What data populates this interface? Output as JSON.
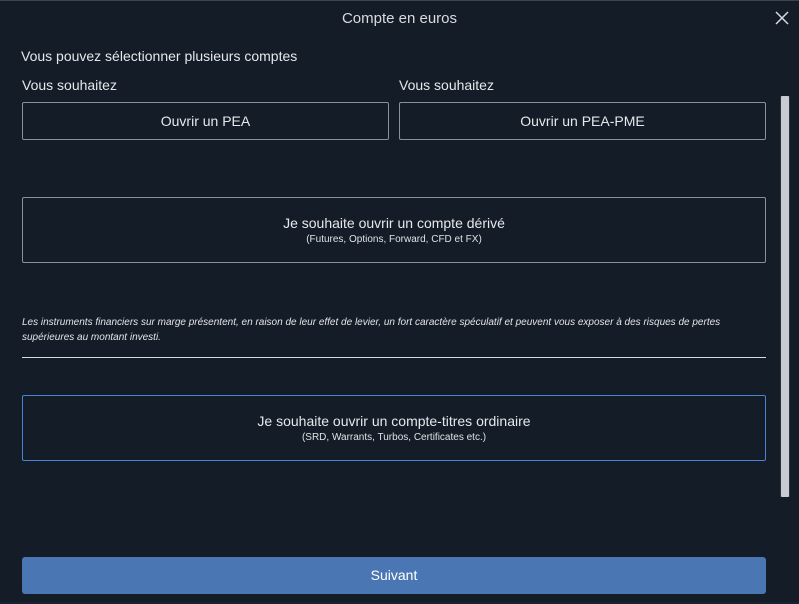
{
  "dialog": {
    "title": "Compte en euros",
    "subtitle": "Vous pouvez sélectionner plusieurs comptes"
  },
  "options": {
    "left_label": "Vous souhaitez",
    "right_label": "Vous souhaitez",
    "pea_button": "Ouvrir un PEA",
    "pea_pme_button": "Ouvrir un PEA-PME",
    "derive": {
      "title": "Je souhaite ouvrir un compte dérivé",
      "subtitle": "(Futures, Options, Forward, CFD et FX)"
    },
    "warning": "Les instruments financiers sur marge présentent, en raison de leur effet de levier, un fort caractère spéculatif et peuvent vous exposer à des risques de pertes supérieures au montant investi.",
    "ordinaire": {
      "title": "Je souhaite ouvrir un compte-titres ordinaire",
      "subtitle": "(SRD, Warrants, Turbos, Certificates etc.)"
    }
  },
  "footer": {
    "next_label": "Suivant"
  },
  "colors": {
    "background": "#141c27",
    "accent": "#4a77b4",
    "selected_border": "#4a82d4"
  },
  "icons": {
    "close": "close-icon"
  }
}
